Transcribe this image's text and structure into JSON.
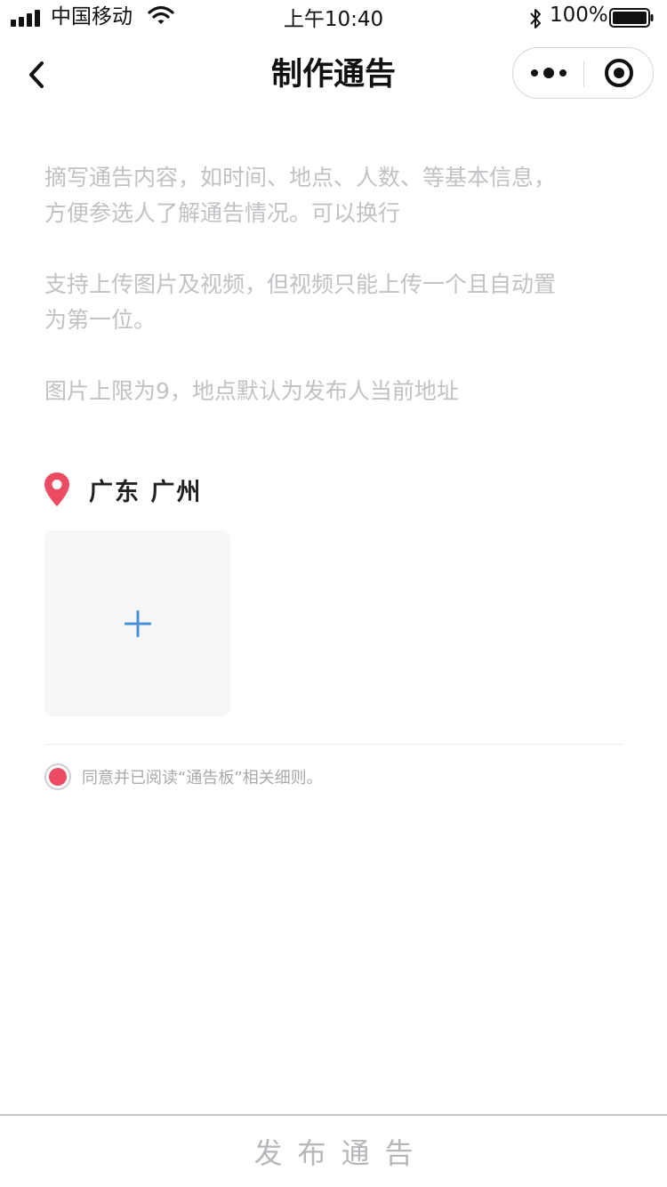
{
  "status_bar": {
    "carrier": "中国移动",
    "time": "上午10:40",
    "battery_percent": "100%",
    "icons": [
      "signal-icon",
      "wifi-icon",
      "bluetooth-icon",
      "battery-icon"
    ]
  },
  "nav": {
    "title": "制作通告",
    "back_icon": "chevron-left-icon",
    "capsule_icons": [
      "more-dots-icon",
      "close-target-icon"
    ]
  },
  "form": {
    "placeholder_lines": [
      "摘写通告内容，如时间、地点、人数、等基本信息，\n方便参选人了解通告情况。可以换行",
      "支持上传图片及视频，但视频只能上传一个且自动置\n为第一位。",
      "图片上限为9，地点默认为发布人当前地址"
    ],
    "location": "广东 广州",
    "location_icon": "map-pin-icon",
    "upload_icon": "plus-icon",
    "agreement": "同意并已阅读“通告板”相关细则。",
    "agreement_checked": true
  },
  "footer": {
    "publish_label": "发布通告"
  },
  "colors": {
    "accent_red": "#ec4c63",
    "plus_blue": "#4a90d9",
    "placeholder_gray": "#c2c2c6"
  }
}
